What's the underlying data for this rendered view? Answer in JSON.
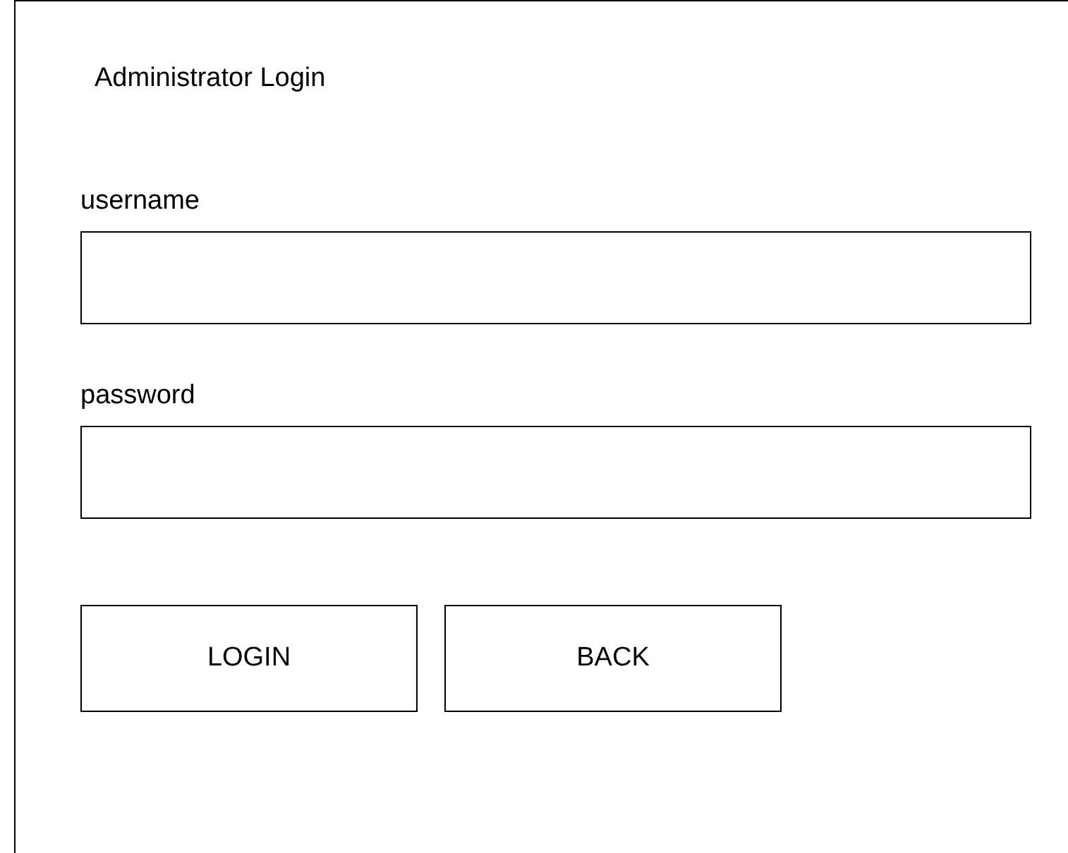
{
  "title": "Administrator Login",
  "fields": [
    {
      "label": "username"
    },
    {
      "label": "password"
    }
  ],
  "buttons": [
    "LOGIN",
    "BACK"
  ]
}
